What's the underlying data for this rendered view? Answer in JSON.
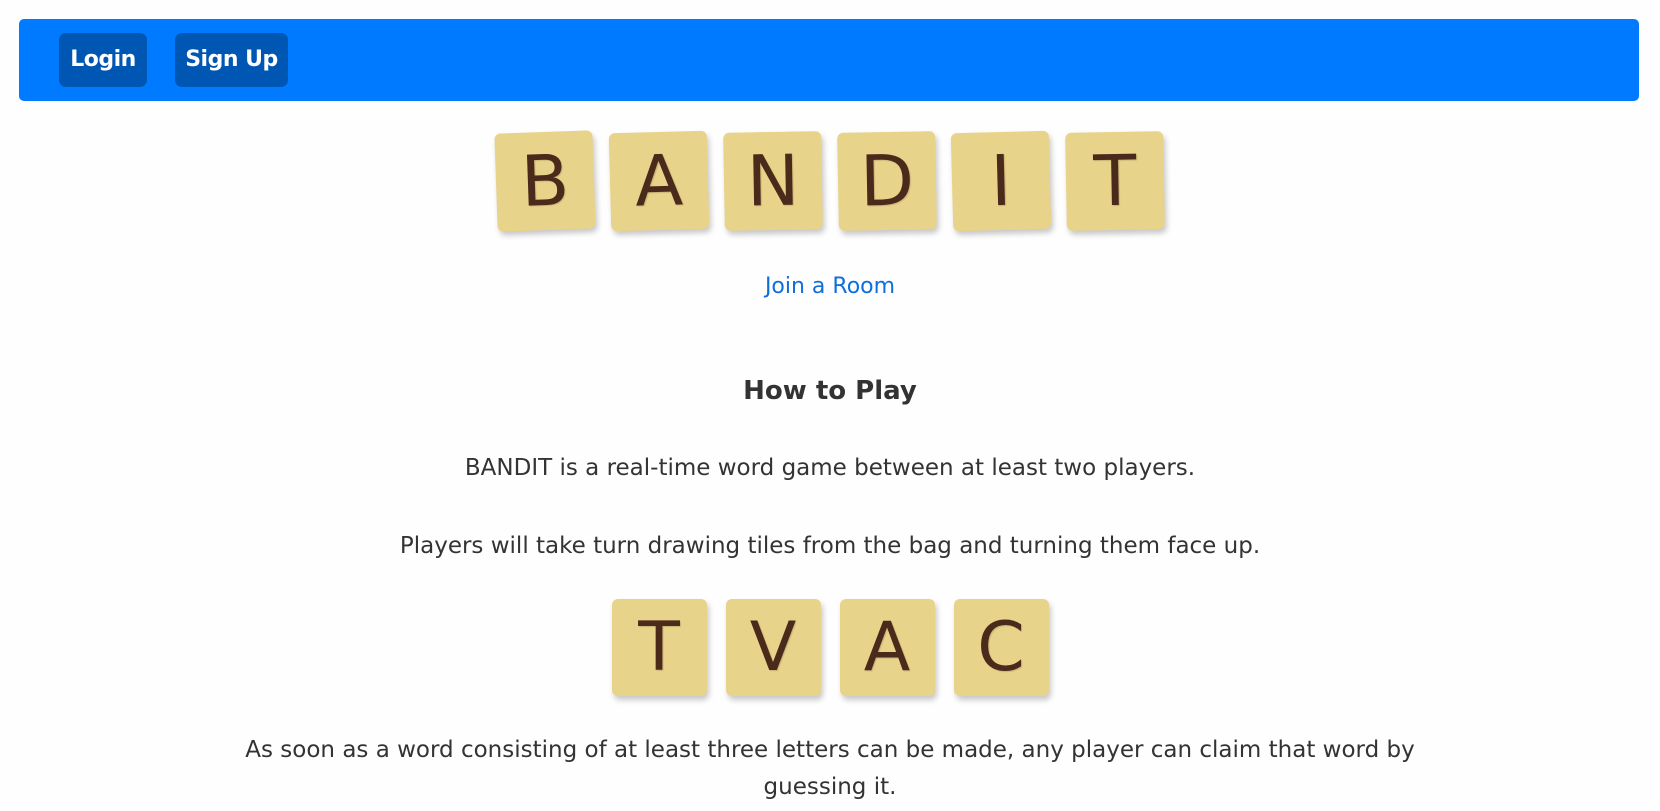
{
  "navbar": {
    "login_label": "Login",
    "signup_label": "Sign Up",
    "bg_color": "#007bff",
    "button_color": "#0056b3"
  },
  "title_tiles": [
    "B",
    "A",
    "N",
    "D",
    "I",
    "T"
  ],
  "join_link": "Join a Room",
  "how_to_play": {
    "heading": "How to Play",
    "paragraph_1": "BANDIT is a real-time word game between at least two players.",
    "paragraph_2": "Players will take turn drawing tiles from the bag and turning them face up.",
    "example_tiles": [
      "T",
      "V",
      "A",
      "C"
    ],
    "paragraph_3": "As soon as a word consisting of at least three letters can be made, any player can claim that word by guessing it."
  },
  "colors": {
    "tile": "#e8d38a",
    "tile_letter": "#4a2a1a",
    "link": "#0d6fdc"
  }
}
